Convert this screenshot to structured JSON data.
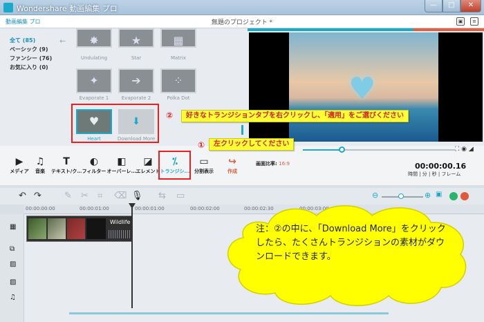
{
  "window": {
    "title": "Wondershare 動画編集 プロ",
    "min_glyph": "—",
    "max_glyph": "□",
    "close_glyph": "✕"
  },
  "app": {
    "brand": "動画編集 プロ",
    "project_title": "無題のプロジェクト *"
  },
  "library": {
    "categories": [
      {
        "label": "全て (85)",
        "selected": true
      },
      {
        "label": "ベーシック (9)",
        "selected": false
      },
      {
        "label": "ファンシー (76)",
        "selected": false
      },
      {
        "label": "お気に入り (0)",
        "selected": false
      }
    ],
    "transitions": [
      {
        "label": "Undulating",
        "glyph": "✸"
      },
      {
        "label": "Star",
        "glyph": "★"
      },
      {
        "label": "Matrix",
        "glyph": "▦"
      },
      {
        "label": "Evaporate 1",
        "glyph": "✦"
      },
      {
        "label": "Evaporate 2",
        "glyph": "➔"
      },
      {
        "label": "Polka Dot",
        "glyph": "⁘"
      },
      {
        "label": "Heart",
        "glyph": "♥"
      },
      {
        "label": "Download More",
        "glyph": "⬇"
      }
    ]
  },
  "callouts": {
    "step2_num": "②",
    "step2_text": "好きなトランジションタブを右クリックし、「適用」をご選びください",
    "step1_num": "①",
    "step1_text": "左クリックしてください"
  },
  "toolbar": {
    "tools": [
      {
        "label": "メディア",
        "icon": "▶"
      },
      {
        "label": "音楽",
        "icon": "♫"
      },
      {
        "label": "テキスト/ク...",
        "icon": "T"
      },
      {
        "label": "フィルター",
        "icon": "◐"
      },
      {
        "label": "オーバーレ...",
        "icon": "◧"
      },
      {
        "label": "エレメント",
        "icon": "◪"
      },
      {
        "label": "トランジシ...",
        "icon": "⁒"
      },
      {
        "label": "分割表示",
        "icon": "▭"
      },
      {
        "label": "作成",
        "icon": "↪"
      }
    ],
    "aspect_label": "画面比率:",
    "aspect_value": "16:9",
    "timecode": "00:00:00.16",
    "timecode_format": "時間 | 分 | 秒 | フレーム"
  },
  "timeline": {
    "ruler": [
      "00:00:00:00",
      "00:00:01:00",
      "00:00:01:00",
      "00:00:02:00",
      "00:00:02:30",
      "00:00:03:00"
    ],
    "clip_title": "Wildlife"
  },
  "note": {
    "text": "注：②の中に、「Download More」をクリックしたら、たくさんトランジションの素材がダウンロードできます。"
  },
  "colors": {
    "accent": "#1aa9c9",
    "highlight_box": "#e82020",
    "callout_bg": "#ffff33",
    "create_orange": "#e05a3a"
  }
}
